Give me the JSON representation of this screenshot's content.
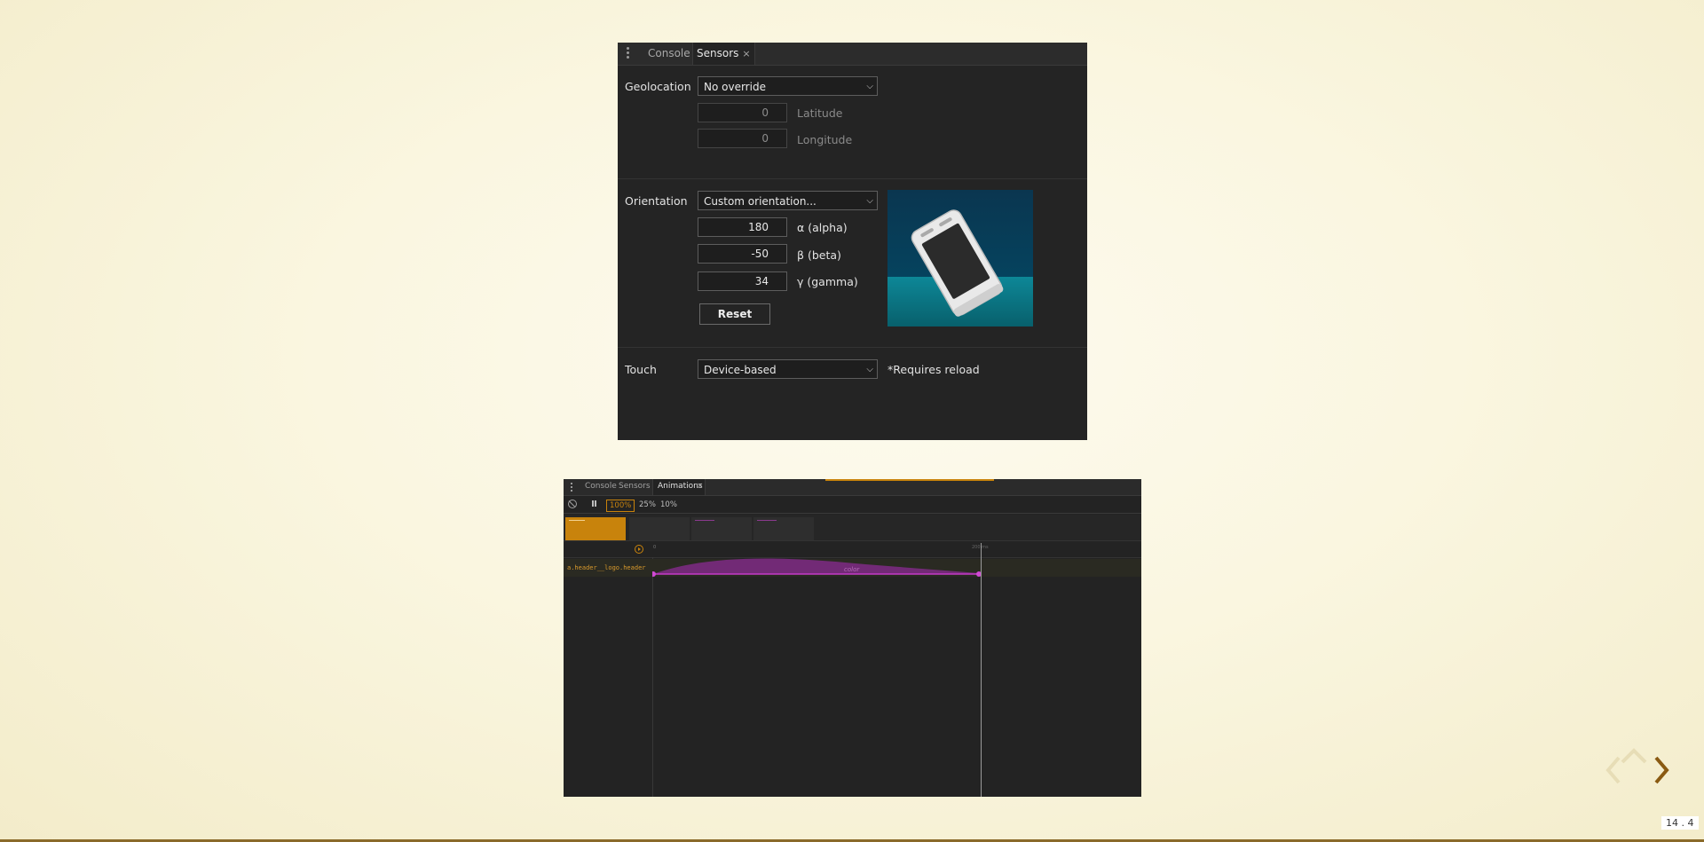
{
  "sensors_panel": {
    "tabs": [
      {
        "label": "Console"
      },
      {
        "label": "Sensors",
        "close": "×"
      }
    ],
    "geolocation": {
      "label": "Geolocation",
      "select_value": "No override",
      "latitude_value": "0",
      "latitude_label": "Latitude",
      "longitude_value": "0",
      "longitude_label": "Longitude"
    },
    "orientation": {
      "label": "Orientation",
      "select_value": "Custom orientation...",
      "alpha_value": "180",
      "alpha_label": "α (alpha)",
      "beta_value": "-50",
      "beta_label": "β (beta)",
      "gamma_value": "34",
      "gamma_label": "γ (gamma)",
      "reset_label": "Reset"
    },
    "touch": {
      "label": "Touch",
      "select_value": "Device-based",
      "note": "*Requires reload"
    }
  },
  "animations_panel": {
    "tabs": [
      {
        "label": "Console"
      },
      {
        "label": "Sensors"
      },
      {
        "label": "Animations",
        "close": "×"
      }
    ],
    "speeds": [
      "100%",
      "25%",
      "10%"
    ],
    "selected_speed": "100%",
    "timeline": {
      "selector": "a.header__logo.header",
      "property": "color",
      "time_start": "0",
      "time_mark": "200 ms"
    }
  },
  "navigation": {
    "slide_number": "14 . 4"
  },
  "colors": {
    "accent_orange": "#c8830c",
    "curve_purple": "#9a2ea0",
    "panel_bg": "#242424"
  },
  "icons": [
    "more-vert-icon",
    "clear-icon",
    "pause-icon",
    "replay-icon",
    "nav-up-icon",
    "nav-left-icon",
    "nav-right-icon",
    "phone-orientation-preview"
  ]
}
